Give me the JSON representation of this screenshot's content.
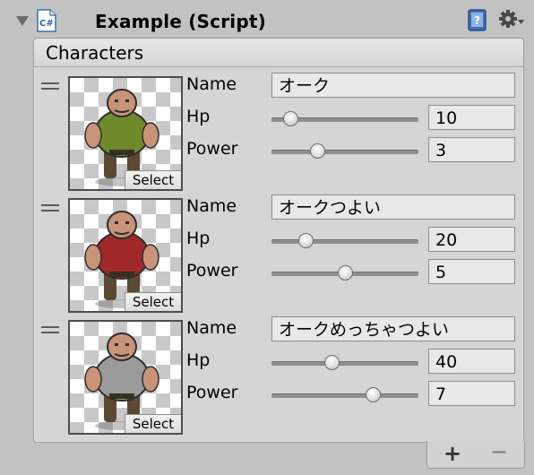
{
  "component": {
    "title": "Example (Script)",
    "script_icon_glyph": "C#",
    "icons": [
      "foldout-arrow-icon",
      "csharp-script-icon",
      "help-book-icon",
      "gear-icon"
    ]
  },
  "list": {
    "header": "Characters",
    "select_label": "Select",
    "field_labels": {
      "name": "Name",
      "hp": "Hp",
      "power": "Power"
    },
    "slider_ranges": {
      "hp": [
        0,
        100
      ],
      "power": [
        0,
        10
      ]
    },
    "elements": [
      {
        "name": "オーク",
        "hp": "10",
        "power": "3",
        "hp_fraction": 0.13,
        "power_fraction": 0.31,
        "sprite_color": "#6f8a2c"
      },
      {
        "name": "オークつよい",
        "hp": "20",
        "power": "5",
        "hp_fraction": 0.23,
        "power_fraction": 0.5,
        "sprite_color": "#a02828"
      },
      {
        "name": "オークめっちゃつよい",
        "hp": "40",
        "power": "7",
        "hp_fraction": 0.41,
        "power_fraction": 0.69,
        "sprite_color": "#9a9a9a"
      }
    ],
    "footer": {
      "add_label": "+",
      "remove_label": "−"
    }
  }
}
